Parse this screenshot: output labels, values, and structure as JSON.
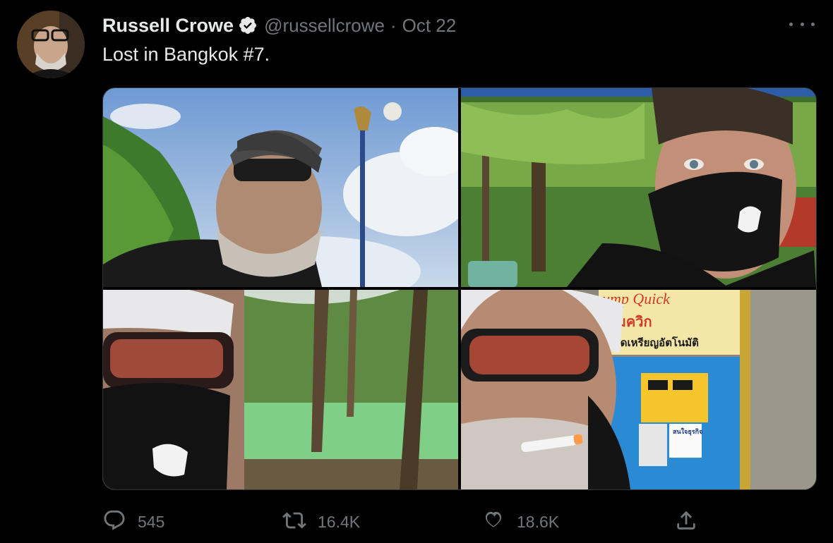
{
  "tweet": {
    "display_name": "Russell Crowe",
    "handle": "@russellcrowe",
    "separator": "·",
    "date": "Oct 22",
    "text": "Lost in Bangkok #7.",
    "verified": true
  },
  "media": {
    "photo_count": 4,
    "photos": [
      {
        "name": "photo-selfie-lamp-post",
        "sign_text": ""
      },
      {
        "name": "photo-selfie-masked-trees",
        "sign_text": ""
      },
      {
        "name": "photo-selfie-masked-pond",
        "sign_text": ""
      },
      {
        "name": "photo-selfie-fuel-pump",
        "sign_text_en": "ump Quick",
        "sign_text_th_1": "ปั๊มควิก",
        "sign_text_th_2": "ยอดเหรียญอัตโนมัติ",
        "sign_text_small": "สนใจธุรกิจ"
      }
    ]
  },
  "actions": {
    "reply_count": "545",
    "retweet_count": "16.4K",
    "like_count": "18.6K"
  },
  "icons": {
    "verified": "verified-badge-icon",
    "more": "more-dots-icon",
    "reply": "reply-icon",
    "retweet": "retweet-icon",
    "like": "heart-icon",
    "share": "share-icon"
  },
  "colors": {
    "background": "#000000",
    "text": "#e7e9ea",
    "muted": "#71767b",
    "border": "#333639"
  }
}
